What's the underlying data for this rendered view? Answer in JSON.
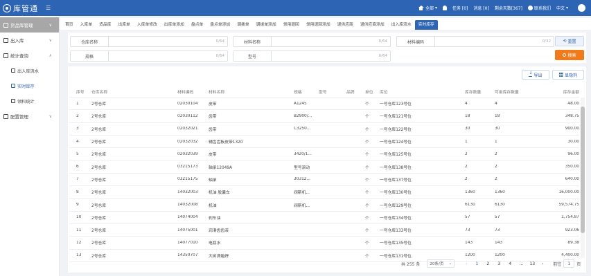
{
  "header": {
    "logo_text": "库管通",
    "scope": "全部",
    "task": "任务 [0]",
    "message": "消息 [0]",
    "trial": "剩余天数[367]",
    "contact": "联系我们",
    "lang": "中文"
  },
  "sidebar": {
    "groups": [
      {
        "label": "货品库管理"
      },
      {
        "label": "出入库"
      },
      {
        "label": "统计查询"
      },
      {
        "label": "配置管理"
      }
    ],
    "subitems": [
      {
        "label": "出入库流水"
      },
      {
        "label": "实时库存"
      },
      {
        "label": "领料统计"
      }
    ]
  },
  "tabs": [
    "首页",
    "入库单",
    "货品库",
    "出库单",
    "入库单修改",
    "出库单添加",
    "盘点单",
    "盘点单添加",
    "调拨单",
    "调拨单添加",
    "领用退回",
    "领用退回添加",
    "退供应商",
    "退供应商添加",
    "出入库流水",
    "实时库存"
  ],
  "filter": {
    "warehouse_name": {
      "label": "仓库名称",
      "count": "0/64"
    },
    "material_name": {
      "label": "材料名称",
      "count": "0/64"
    },
    "material_code": {
      "label": "材料编码",
      "count": "0/32"
    },
    "spec": {
      "label": "规格",
      "count": "0/64"
    },
    "model": {
      "label": "型号",
      "count": "0/64"
    },
    "reset_label": "重置",
    "search_label": "搜索"
  },
  "toolbar": {
    "export_label": "导出",
    "columns_label": "显隐列"
  },
  "table": {
    "headers": [
      "序号",
      "仓库名称",
      "材料编码",
      "材料名称",
      "规格",
      "型号",
      "品牌",
      "单位",
      "库位",
      "库存数量",
      "可用库存数量",
      "库存金额"
    ],
    "rows": [
      [
        "1",
        "2号仓库",
        "02030104",
        "皮带",
        "A1245",
        "",
        "",
        "个",
        "一号仓库123号位",
        "4",
        "4",
        "48.00"
      ],
      [
        "2",
        "2号仓库",
        "02030112",
        "齿带",
        "B2900/...",
        "",
        "",
        "个",
        "一号仓库121号位",
        "18",
        "18",
        "348.75"
      ],
      [
        "3",
        "2号仓库",
        "02032021",
        "齿带",
        "C3250...",
        "",
        "",
        "个",
        "一号仓库122号位",
        "30",
        "30",
        "900.00"
      ],
      [
        "4",
        "2号仓库",
        "02032032",
        "辅齿齿板皮带1320",
        "",
        "",
        "",
        "个",
        "一号仓库124号位",
        "1",
        "1",
        "30.00"
      ],
      [
        "5",
        "2号仓库",
        "02032039",
        "皮带",
        "3420/1...",
        "",
        "",
        "个",
        "一号仓库125号位",
        "2",
        "2",
        "96.00"
      ],
      [
        "6",
        "2号仓库",
        "03215173",
        "轴承12049A",
        "型号滚动",
        "",
        "",
        "个",
        "一号仓库138号位",
        "2",
        "2",
        "350.00"
      ],
      [
        "7",
        "2号仓库",
        "03215175",
        "轴承",
        "30312...",
        "",
        "",
        "个",
        "一号仓库137号位",
        "2",
        "2",
        "640.00"
      ],
      [
        "8",
        "2号仓库",
        "14032003",
        "机油 胶囊车",
        "阀斯机...",
        "",
        "",
        "个",
        "一号仓库130号位",
        "1360",
        "1360",
        "16,000.00"
      ],
      [
        "9",
        "2号仓库",
        "14032008",
        "机油",
        "阀斯机...",
        "",
        "",
        "个",
        "一号仓库129号位",
        "6130",
        "6130",
        "59,574.75"
      ],
      [
        "10",
        "2号仓库",
        "14074004",
        "刹车油",
        "",
        "",
        "",
        "个",
        "一号仓库134号位",
        "57",
        "57",
        "1,754.87"
      ],
      [
        "11",
        "2号仓库",
        "14075001",
        "润滑齿齿液",
        "",
        "",
        "",
        "个",
        "一号仓库133号位",
        "73",
        "73",
        "923.06"
      ],
      [
        "12",
        "2号仓库",
        "14077010",
        "电瓶水",
        "",
        "",
        "",
        "个",
        "一号仓库135号位",
        "143",
        "143",
        "89.38"
      ],
      [
        "13",
        "2号仓库",
        "14350707",
        "大树滴箱焊",
        "",
        "",
        "",
        "个",
        "一号仓库131号位",
        "1200",
        "1200",
        "4,400.00"
      ]
    ]
  },
  "pagination": {
    "total": "共 255 条",
    "page_size": "20条/页",
    "pages": [
      "1",
      "2",
      "3",
      "4",
      "...",
      "13"
    ],
    "goto_label": "前往",
    "goto_value": "1",
    "page_unit": "页"
  },
  "colors": {
    "primary": "#2d64b3",
    "accent": "#f07a1c"
  }
}
